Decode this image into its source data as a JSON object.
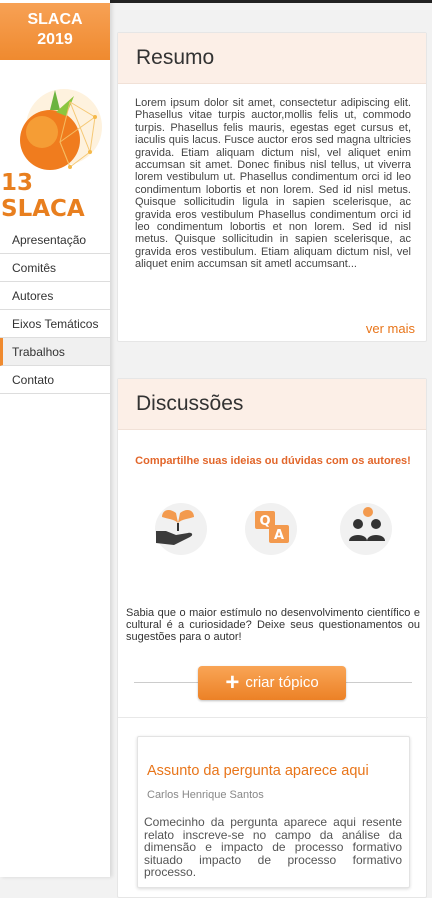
{
  "sidebar": {
    "brand_line1": "SLACA",
    "brand_line2": "2019",
    "logo_text": "13 SLACA",
    "menu": [
      {
        "label": "Apresentação"
      },
      {
        "label": "Comitês"
      },
      {
        "label": "Autores"
      },
      {
        "label": "Eixos Temáticos"
      },
      {
        "label": "Trabalhos",
        "active": true
      },
      {
        "label": "Contato"
      }
    ]
  },
  "resumo": {
    "title": "Resumo",
    "text": "Lorem ipsum dolor sit amet, consectetur adipiscing elit. Phasellus vitae turpis auctor,mollis felis ut, commodo turpis. Phasellus felis mauris, egestas eget cursus et, iaculis quis lacus. Fusce auctor eros sed magna ultricies gravida. Etiam aliquam dictum nisl, vel aliquet enim accumsan sit amet. Donec finibus nisl tellus, ut viverra lorem vestibulum ut. Phasellus condimentum orci id leo condimentum lobortis et non lorem. Sed id nisl metus. Quisque sollicitudin ligula in sapien scelerisque, ac gravida eros vestibulum Phasellus condimentum orci id leo condimentum lobortis et non lorem. Sed id nisl metus. Quisque sollicitudin in sapien scelerisque, ac gravida eros vestibulum. Etiam aliquam dictum nisl, vel aliquet enim accumsan sit ametl accumsant...",
    "more_label": "ver mais"
  },
  "discussoes": {
    "title": "Discussões",
    "subtitle": "Compartilhe suas ideias ou dúvidas com os autores!",
    "icons": [
      "hand-plant-icon",
      "question-answer-icon",
      "people-icon"
    ],
    "text": "Sabia que o maior estímulo no desenvolvimento científico e cultural é a curiosidade? Deixe seus questionamentos ou sugestões para o autor!",
    "create_label": "criar tópico"
  },
  "topic": {
    "title": "Assunto da pergunta aparece aqui",
    "author": "Carlos Henrique Santos",
    "text": "Comecinho da pergunta aparece aqui resente relato inscreve-se no campo da análise da dimensão e impacto de processo formativo situado impacto de processo formativo processo."
  },
  "colors": {
    "accent": "#ef8a2f",
    "accent_text": "#e8751a",
    "header_bg": "#fcefe7"
  }
}
